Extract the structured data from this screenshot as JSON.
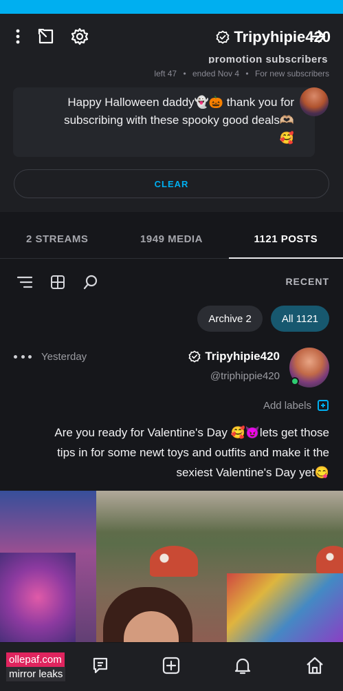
{
  "header": {
    "title": "Tripyhipie420",
    "icons": [
      "back-arrow-icon",
      "gear-icon",
      "share-icon",
      "more-vertical-icon"
    ]
  },
  "promotion": {
    "cut_title": "promotion subscribers",
    "meta": [
      "For new subscribers",
      "•",
      "ended Nov 4",
      "•",
      "left 47"
    ],
    "message_line1": "Happy Halloween daddy👻🎃 thank you for",
    "message_line2": "subscribing with these spooky good deals🫶🏼",
    "message_line3": "🥰",
    "clear_label": "CLEAR"
  },
  "tabs": [
    {
      "label": "1121 POSTS",
      "active": true
    },
    {
      "label": "1949 MEDIA",
      "active": false
    },
    {
      "label": "2 STREAMS",
      "active": false
    }
  ],
  "filter": {
    "recent_label": "RECENT"
  },
  "chips": [
    {
      "label": "All 1121",
      "active": true
    },
    {
      "label": "Archive 2",
      "active": false
    }
  ],
  "post": {
    "name": "Tripyhipie420",
    "handle": "@triphippie420",
    "time": "Yesterday",
    "add_labels": "Add labels",
    "text_line1": "Are you ready for Valentine's Day 🥰😈lets get those",
    "text_line2": "tips in for some newt toys and outfits and make it the",
    "text_line3": "sexiest Valentine's Day yet😋"
  },
  "watermark": {
    "line1": "ollepaf.com",
    "line2": "mirror leaks"
  },
  "colors": {
    "accent": "#00aff0",
    "background": "#16171b",
    "surface": "#1e1f23",
    "chip_active": "#17586f",
    "online": "#2ecc71"
  }
}
